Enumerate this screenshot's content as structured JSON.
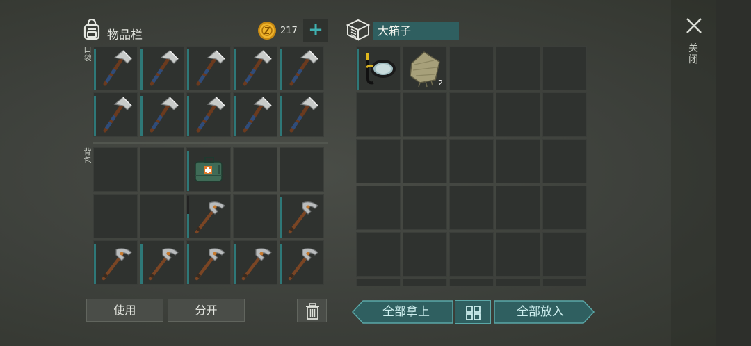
{
  "inventory": {
    "title": "物品栏",
    "coins": "217",
    "add_coins_symbol": "+",
    "pocket_label": "口袋",
    "backpack_label": "背包",
    "pocket_slots": [
      {
        "item": "hatchet-icon"
      },
      {
        "item": "hatchet-icon"
      },
      {
        "item": "hatchet-icon"
      },
      {
        "item": "hatchet-icon"
      },
      {
        "item": "hatchet-icon"
      },
      {
        "item": "hatchet-icon"
      },
      {
        "item": "hatchet-icon"
      },
      {
        "item": "hatchet-icon"
      },
      {
        "item": "hatchet-icon"
      },
      {
        "item": "hatchet-icon"
      }
    ],
    "backpack_slots": [
      {
        "item": null
      },
      {
        "item": null
      },
      {
        "item": "medkit-icon"
      },
      {
        "item": null
      },
      {
        "item": null
      },
      {
        "item": null
      },
      {
        "item": null
      },
      {
        "item": "pickaxe-icon"
      },
      {
        "item": null
      },
      {
        "item": "pickaxe-icon"
      },
      {
        "item": "pickaxe-icon"
      },
      {
        "item": "pickaxe-icon"
      },
      {
        "item": "pickaxe-icon"
      },
      {
        "item": "pickaxe-icon"
      },
      {
        "item": "pickaxe-icon"
      }
    ]
  },
  "container": {
    "name": "大箱子",
    "slots": [
      {
        "item": "snorkel-icon",
        "qty": ""
      },
      {
        "item": "cloth-icon",
        "qty": "2"
      }
    ]
  },
  "close_label": "关闭",
  "buttons": {
    "use": "使用",
    "split": "分开",
    "take_all": "全部拿上",
    "put_all": "全部放入"
  },
  "colors": {
    "accent_teal": "#2f5f60",
    "teal_border": "#5aa7a7",
    "coin_gold": "#e0a823"
  }
}
